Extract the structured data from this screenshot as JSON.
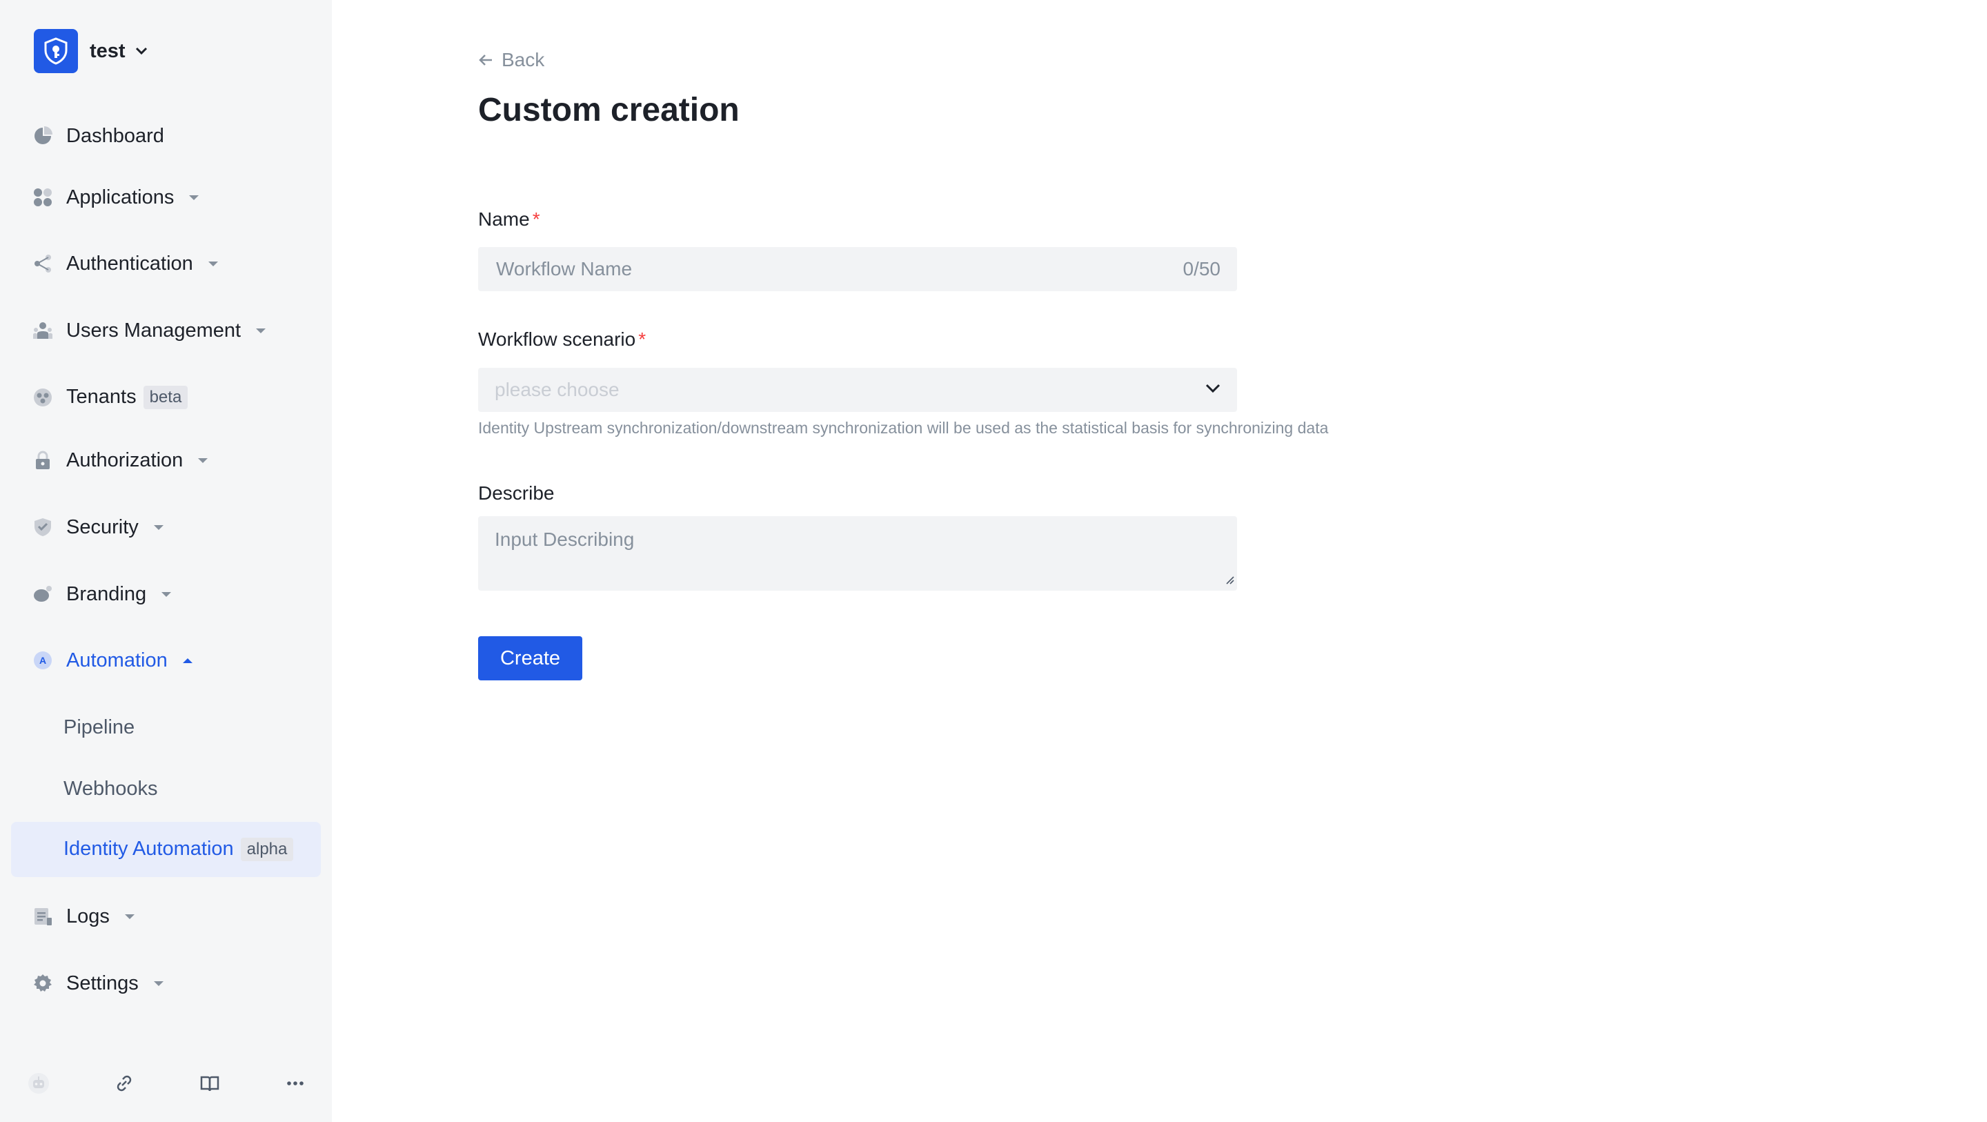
{
  "org": {
    "name": "test"
  },
  "sidebar": {
    "items": [
      {
        "label": "Dashboard"
      },
      {
        "label": "Applications"
      },
      {
        "label": "Authentication"
      },
      {
        "label": "Users Management"
      },
      {
        "label": "Tenants",
        "badge": "beta"
      },
      {
        "label": "Authorization"
      },
      {
        "label": "Security"
      },
      {
        "label": "Branding"
      },
      {
        "label": "Automation"
      },
      {
        "label": "Logs"
      },
      {
        "label": "Settings"
      }
    ],
    "automation_sub": [
      {
        "label": "Pipeline"
      },
      {
        "label": "Webhooks"
      },
      {
        "label": "Identity Automation",
        "badge": "alpha"
      }
    ]
  },
  "page": {
    "back_label": "Back",
    "title": "Custom creation"
  },
  "form": {
    "name_label": "Name",
    "name_placeholder": "Workflow Name",
    "name_counter": "0/50",
    "scenario_label": "Workflow scenario",
    "scenario_placeholder": "please choose",
    "scenario_hint": "Identity Upstream synchronization/downstream synchronization will be used as the statistical basis for synchronizing data",
    "describe_label": "Describe",
    "describe_placeholder": "Input Describing",
    "required_mark": "*",
    "create_label": "Create"
  },
  "colors": {
    "primary": "#215ae5",
    "sidebar_bg": "#f5f6f7",
    "selected_bg": "#e8edfb",
    "required": "#f53f3f"
  }
}
